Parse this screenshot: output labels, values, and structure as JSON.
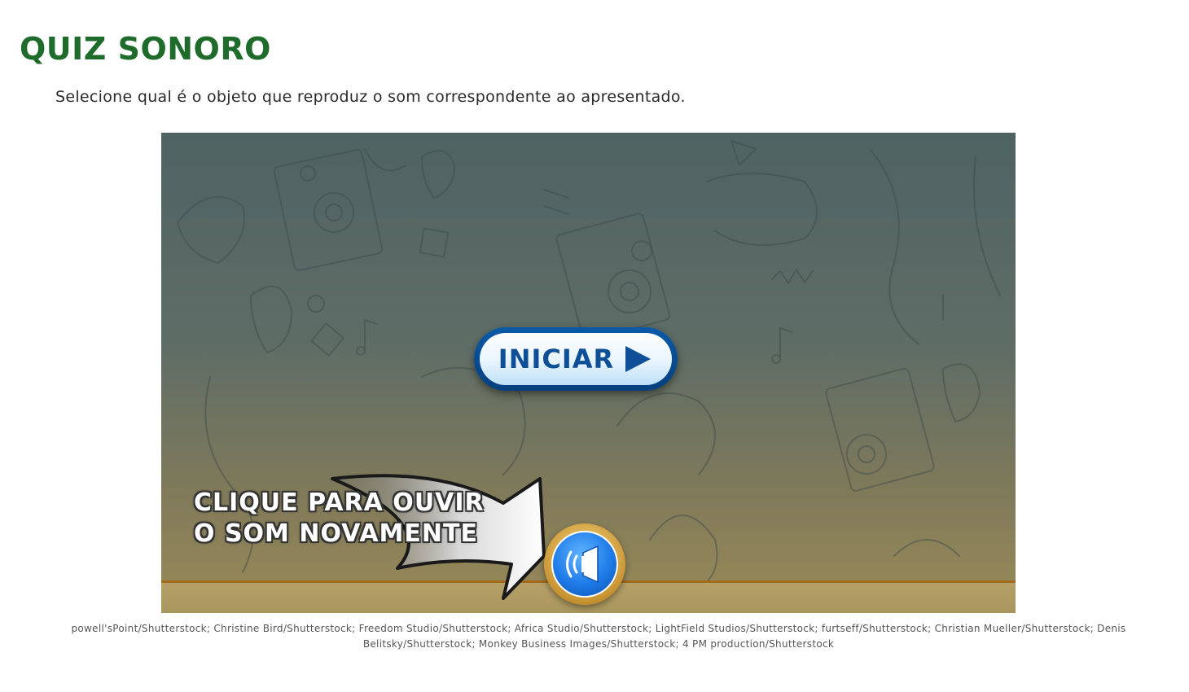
{
  "page": {
    "title": "QUIZ SONORO",
    "instruction": "Selecione qual é o objeto que reproduz o som correspondente ao apresentado."
  },
  "game": {
    "start_button_label": "INICIAR",
    "start_button_icon": "play-icon",
    "hint_line1": "CLIQUE PARA OUVIR",
    "hint_line2": "O SOM NOVAMENTE",
    "sound_button_icon": "speaker-icon"
  },
  "credits": "powell'sPoint/Shutterstock; Christine Bird/Shutterstock; Freedom Studio/Shutterstock; Africa Studio/Shutterstock; LightField Studios/Shutterstock; furtseff/Shutterstock; Christian Mueller/Shutterstock; Denis Belitsky/Shutterstock; Monkey Business Images/Shutterstock; 4 PM production/Shutterstock",
  "colors": {
    "title": "#1f6b2c",
    "button_blue": "#0f4f98",
    "floor_edge": "#a46a1c"
  }
}
